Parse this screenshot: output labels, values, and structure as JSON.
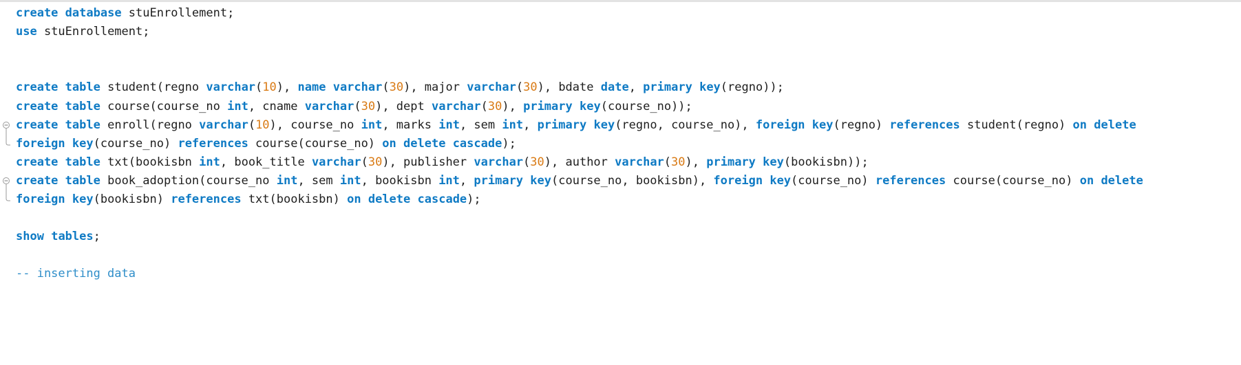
{
  "editor": {
    "lines": [
      {
        "fold": false,
        "segments": [
          {
            "t": "create",
            "k": "kw"
          },
          {
            "t": " ",
            "k": "txt"
          },
          {
            "t": "database",
            "k": "kw"
          },
          {
            "t": " stuEnrollement;",
            "k": "txt"
          }
        ]
      },
      {
        "fold": false,
        "segments": [
          {
            "t": "use",
            "k": "kw"
          },
          {
            "t": " stuEnrollement;",
            "k": "txt"
          }
        ]
      },
      {
        "fold": false,
        "segments": []
      },
      {
        "fold": false,
        "segments": []
      },
      {
        "fold": false,
        "segments": [
          {
            "t": "create",
            "k": "kw"
          },
          {
            "t": " ",
            "k": "txt"
          },
          {
            "t": "table",
            "k": "kw"
          },
          {
            "t": " student(regno ",
            "k": "txt"
          },
          {
            "t": "varchar",
            "k": "kw"
          },
          {
            "t": "(",
            "k": "txt"
          },
          {
            "t": "10",
            "k": "num"
          },
          {
            "t": "), ",
            "k": "txt"
          },
          {
            "t": "name",
            "k": "kw"
          },
          {
            "t": " ",
            "k": "txt"
          },
          {
            "t": "varchar",
            "k": "kw"
          },
          {
            "t": "(",
            "k": "txt"
          },
          {
            "t": "30",
            "k": "num"
          },
          {
            "t": "), major ",
            "k": "txt"
          },
          {
            "t": "varchar",
            "k": "kw"
          },
          {
            "t": "(",
            "k": "txt"
          },
          {
            "t": "30",
            "k": "num"
          },
          {
            "t": "), bdate ",
            "k": "txt"
          },
          {
            "t": "date",
            "k": "kw"
          },
          {
            "t": ", ",
            "k": "txt"
          },
          {
            "t": "primary",
            "k": "kw"
          },
          {
            "t": " ",
            "k": "txt"
          },
          {
            "t": "key",
            "k": "kw"
          },
          {
            "t": "(regno));",
            "k": "txt"
          }
        ]
      },
      {
        "fold": false,
        "segments": [
          {
            "t": "create",
            "k": "kw"
          },
          {
            "t": " ",
            "k": "txt"
          },
          {
            "t": "table",
            "k": "kw"
          },
          {
            "t": " course(course_no ",
            "k": "txt"
          },
          {
            "t": "int",
            "k": "kw"
          },
          {
            "t": ", cname ",
            "k": "txt"
          },
          {
            "t": "varchar",
            "k": "kw"
          },
          {
            "t": "(",
            "k": "txt"
          },
          {
            "t": "30",
            "k": "num"
          },
          {
            "t": "), dept ",
            "k": "txt"
          },
          {
            "t": "varchar",
            "k": "kw"
          },
          {
            "t": "(",
            "k": "txt"
          },
          {
            "t": "30",
            "k": "num"
          },
          {
            "t": "), ",
            "k": "txt"
          },
          {
            "t": "primary",
            "k": "kw"
          },
          {
            "t": " ",
            "k": "txt"
          },
          {
            "t": "key",
            "k": "kw"
          },
          {
            "t": "(course_no));",
            "k": "txt"
          }
        ]
      },
      {
        "fold": "open",
        "segments": [
          {
            "t": "create",
            "k": "kw"
          },
          {
            "t": " ",
            "k": "txt"
          },
          {
            "t": "table",
            "k": "kw"
          },
          {
            "t": " enroll(regno ",
            "k": "txt"
          },
          {
            "t": "varchar",
            "k": "kw"
          },
          {
            "t": "(",
            "k": "txt"
          },
          {
            "t": "10",
            "k": "num"
          },
          {
            "t": "), course_no ",
            "k": "txt"
          },
          {
            "t": "int",
            "k": "kw"
          },
          {
            "t": ", marks ",
            "k": "txt"
          },
          {
            "t": "int",
            "k": "kw"
          },
          {
            "t": ", sem ",
            "k": "txt"
          },
          {
            "t": "int",
            "k": "kw"
          },
          {
            "t": ", ",
            "k": "txt"
          },
          {
            "t": "primary",
            "k": "kw"
          },
          {
            "t": " ",
            "k": "txt"
          },
          {
            "t": "key",
            "k": "kw"
          },
          {
            "t": "(regno, course_no), ",
            "k": "txt"
          },
          {
            "t": "foreign",
            "k": "kw"
          },
          {
            "t": " ",
            "k": "txt"
          },
          {
            "t": "key",
            "k": "kw"
          },
          {
            "t": "(regno) ",
            "k": "txt"
          },
          {
            "t": "references",
            "k": "kw"
          },
          {
            "t": " student(regno) ",
            "k": "txt"
          },
          {
            "t": "on",
            "k": "kw"
          },
          {
            "t": " ",
            "k": "txt"
          },
          {
            "t": "delete",
            "k": "kw"
          }
        ]
      },
      {
        "fold": "end",
        "segments": [
          {
            "t": "foreign",
            "k": "kw"
          },
          {
            "t": " ",
            "k": "txt"
          },
          {
            "t": "key",
            "k": "kw"
          },
          {
            "t": "(course_no) ",
            "k": "txt"
          },
          {
            "t": "references",
            "k": "kw"
          },
          {
            "t": " course(course_no) ",
            "k": "txt"
          },
          {
            "t": "on",
            "k": "kw"
          },
          {
            "t": " ",
            "k": "txt"
          },
          {
            "t": "delete",
            "k": "kw"
          },
          {
            "t": " ",
            "k": "txt"
          },
          {
            "t": "cascade",
            "k": "kw"
          },
          {
            "t": ");",
            "k": "txt"
          }
        ]
      },
      {
        "fold": false,
        "segments": [
          {
            "t": "create",
            "k": "kw"
          },
          {
            "t": " ",
            "k": "txt"
          },
          {
            "t": "table",
            "k": "kw"
          },
          {
            "t": " txt(bookisbn ",
            "k": "txt"
          },
          {
            "t": "int",
            "k": "kw"
          },
          {
            "t": ", book_title ",
            "k": "txt"
          },
          {
            "t": "varchar",
            "k": "kw"
          },
          {
            "t": "(",
            "k": "txt"
          },
          {
            "t": "30",
            "k": "num"
          },
          {
            "t": "), publisher ",
            "k": "txt"
          },
          {
            "t": "varchar",
            "k": "kw"
          },
          {
            "t": "(",
            "k": "txt"
          },
          {
            "t": "30",
            "k": "num"
          },
          {
            "t": "), author ",
            "k": "txt"
          },
          {
            "t": "varchar",
            "k": "kw"
          },
          {
            "t": "(",
            "k": "txt"
          },
          {
            "t": "30",
            "k": "num"
          },
          {
            "t": "), ",
            "k": "txt"
          },
          {
            "t": "primary",
            "k": "kw"
          },
          {
            "t": " ",
            "k": "txt"
          },
          {
            "t": "key",
            "k": "kw"
          },
          {
            "t": "(bookisbn));",
            "k": "txt"
          }
        ]
      },
      {
        "fold": "open",
        "segments": [
          {
            "t": "create",
            "k": "kw"
          },
          {
            "t": " ",
            "k": "txt"
          },
          {
            "t": "table",
            "k": "kw"
          },
          {
            "t": " book_adoption(course_no ",
            "k": "txt"
          },
          {
            "t": "int",
            "k": "kw"
          },
          {
            "t": ", sem ",
            "k": "txt"
          },
          {
            "t": "int",
            "k": "kw"
          },
          {
            "t": ", bookisbn ",
            "k": "txt"
          },
          {
            "t": "int",
            "k": "kw"
          },
          {
            "t": ", ",
            "k": "txt"
          },
          {
            "t": "primary",
            "k": "kw"
          },
          {
            "t": " ",
            "k": "txt"
          },
          {
            "t": "key",
            "k": "kw"
          },
          {
            "t": "(course_no, bookisbn), ",
            "k": "txt"
          },
          {
            "t": "foreign",
            "k": "kw"
          },
          {
            "t": " ",
            "k": "txt"
          },
          {
            "t": "key",
            "k": "kw"
          },
          {
            "t": "(course_no) ",
            "k": "txt"
          },
          {
            "t": "references",
            "k": "kw"
          },
          {
            "t": " course(course_no) ",
            "k": "txt"
          },
          {
            "t": "on",
            "k": "kw"
          },
          {
            "t": " ",
            "k": "txt"
          },
          {
            "t": "delete",
            "k": "kw"
          }
        ]
      },
      {
        "fold": "end",
        "segments": [
          {
            "t": "foreign",
            "k": "kw"
          },
          {
            "t": " ",
            "k": "txt"
          },
          {
            "t": "key",
            "k": "kw"
          },
          {
            "t": "(bookisbn) ",
            "k": "txt"
          },
          {
            "t": "references",
            "k": "kw"
          },
          {
            "t": " txt(bookisbn) ",
            "k": "txt"
          },
          {
            "t": "on",
            "k": "kw"
          },
          {
            "t": " ",
            "k": "txt"
          },
          {
            "t": "delete",
            "k": "kw"
          },
          {
            "t": " ",
            "k": "txt"
          },
          {
            "t": "cascade",
            "k": "kw"
          },
          {
            "t": ");",
            "k": "txt"
          }
        ]
      },
      {
        "fold": false,
        "segments": []
      },
      {
        "fold": false,
        "segments": [
          {
            "t": "show",
            "k": "kw"
          },
          {
            "t": " ",
            "k": "txt"
          },
          {
            "t": "tables",
            "k": "kw"
          },
          {
            "t": ";",
            "k": "txt"
          }
        ]
      },
      {
        "fold": false,
        "segments": []
      },
      {
        "fold": false,
        "segments": [
          {
            "t": "-- inserting data",
            "k": "cmt"
          }
        ]
      }
    ]
  },
  "colors": {
    "keyword": "#0e7ac4",
    "number": "#d97a14",
    "text": "#1e1e1e",
    "comment": "#2f8ec9",
    "background": "#ffffff"
  }
}
